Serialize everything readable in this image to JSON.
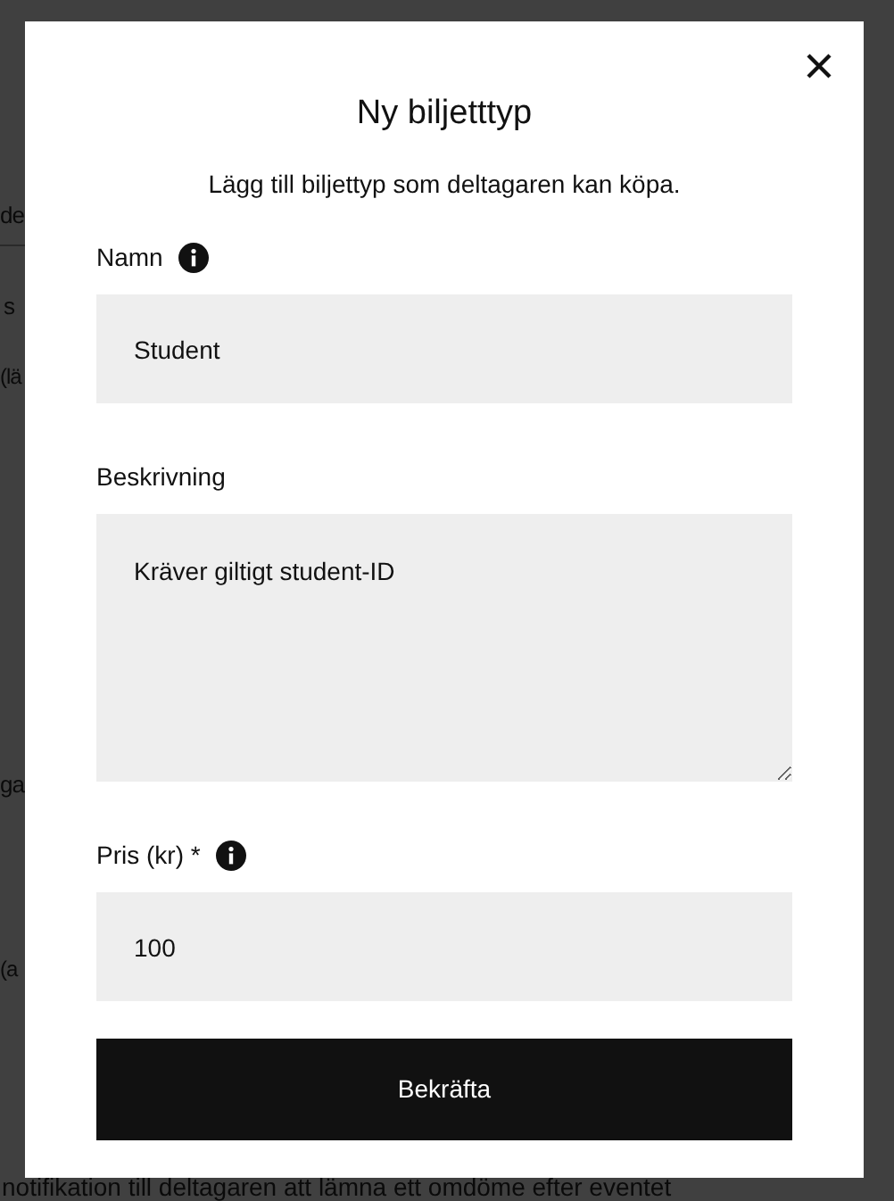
{
  "background_page": {
    "fragments": [
      {
        "text": "de"
      },
      {
        "text": "s"
      },
      {
        "text": "(lä"
      },
      {
        "text": "ga"
      },
      {
        "text": "(a"
      },
      {
        "text": "notifikation till deltagaren att lämna ett omdöme efter eventet"
      }
    ]
  },
  "dialog": {
    "title": "Ny biljetttyp",
    "subtitle": "Lägg till biljettyp som deltagaren kan köpa.",
    "fields": [
      {
        "kind": "input",
        "label": "Namn",
        "info": true,
        "value": "Student"
      },
      {
        "kind": "textarea",
        "label": "Beskrivning",
        "info": false,
        "value": "Kräver giltigt student-ID"
      },
      {
        "kind": "input",
        "label": "Pris (kr) *",
        "info": true,
        "value": "100"
      }
    ],
    "confirm_button": "Bekräfta"
  }
}
